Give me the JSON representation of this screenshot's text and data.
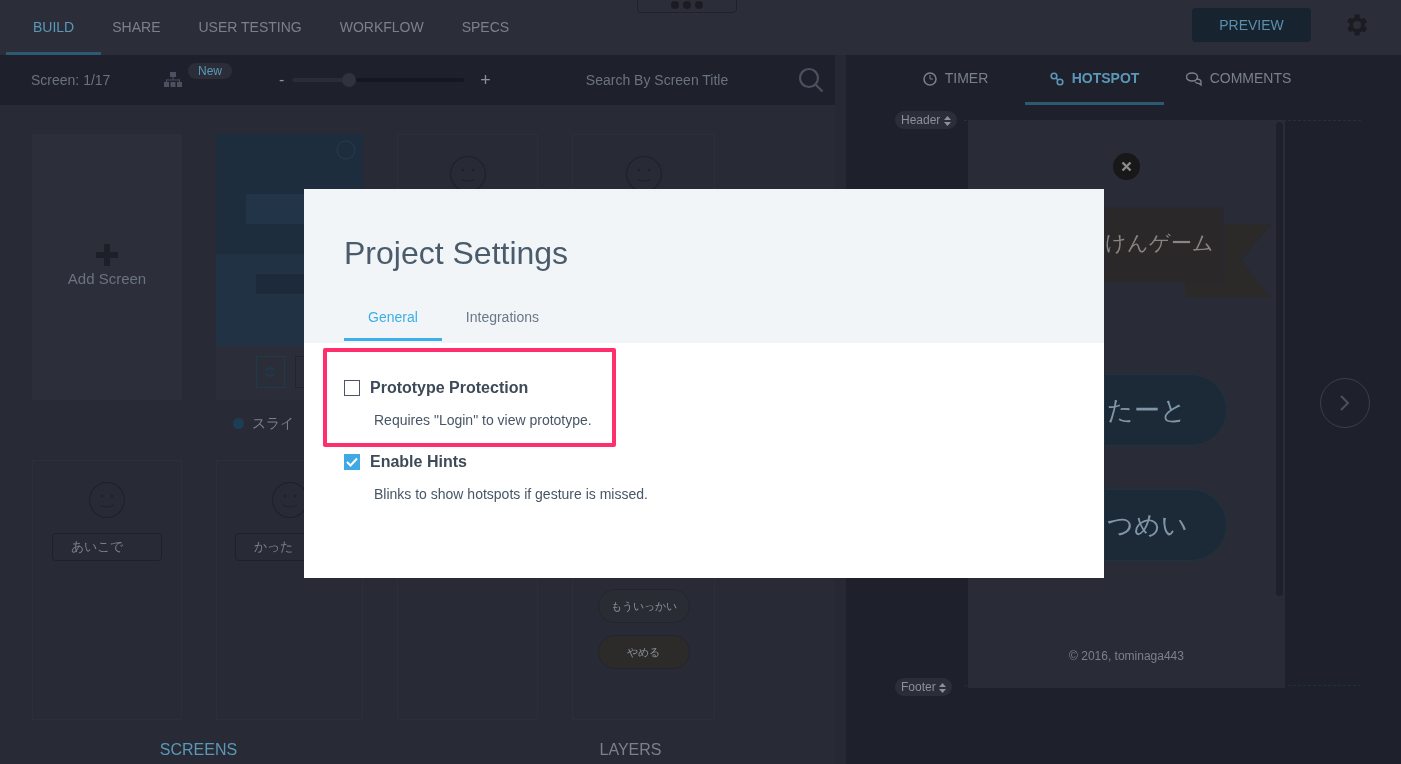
{
  "top_nav": {
    "tabs": [
      {
        "label": "BUILD",
        "selected": true
      },
      {
        "label": "SHARE",
        "selected": false
      },
      {
        "label": "USER TESTING",
        "selected": false
      },
      {
        "label": "WORKFLOW",
        "selected": false
      },
      {
        "label": "SPECS",
        "selected": false
      }
    ],
    "preview_button": "PREVIEW"
  },
  "screen_toolbar": {
    "screen_counter": "Screen: 1/17",
    "new_badge": "New",
    "zoom": {
      "minus": "-",
      "plus": "+",
      "level": 0.33
    },
    "search": {
      "placeholder": "Search By Screen Title"
    }
  },
  "screens": [
    {
      "kind": "add",
      "label": "Add Screen"
    },
    {
      "caption": "スライ"
    },
    {
      "kind": "face"
    },
    {
      "kind": "face"
    },
    {
      "kind": "face",
      "bubble": "あいこで"
    },
    {
      "kind": "face",
      "bubble": "かった"
    },
    {
      "kind": "blank"
    },
    {
      "kind": "buttons",
      "buttons": [
        "もういっかい",
        "やめる"
      ]
    }
  ],
  "bottom_tabs": [
    {
      "label": "SCREENS",
      "selected": true
    },
    {
      "label": "LAYERS",
      "selected": false
    }
  ],
  "preview_panel": {
    "tabs": [
      {
        "label": "TIMER",
        "selected": false
      },
      {
        "label": "HOTSPOT",
        "selected": true
      },
      {
        "label": "COMMENTS",
        "selected": false
      }
    ],
    "header_label": "Header",
    "footer_label": "Footer",
    "phone": {
      "banner": "けんゲーム",
      "buttons": [
        "たーと",
        "つめい"
      ],
      "copyright": "© 2016, tominaga443"
    }
  },
  "modal": {
    "title": "Project Settings",
    "tabs": [
      {
        "label": "General",
        "selected": true
      },
      {
        "label": "Integrations",
        "selected": false
      }
    ],
    "options": [
      {
        "title": "Prototype Protection",
        "description": "Requires \"Login\" to view prototype.",
        "checked": false,
        "highlighted": true
      },
      {
        "title": "Enable Hints",
        "description": "Blinks to show hotspots if gesture is missed.",
        "checked": true,
        "highlighted": false
      }
    ]
  }
}
